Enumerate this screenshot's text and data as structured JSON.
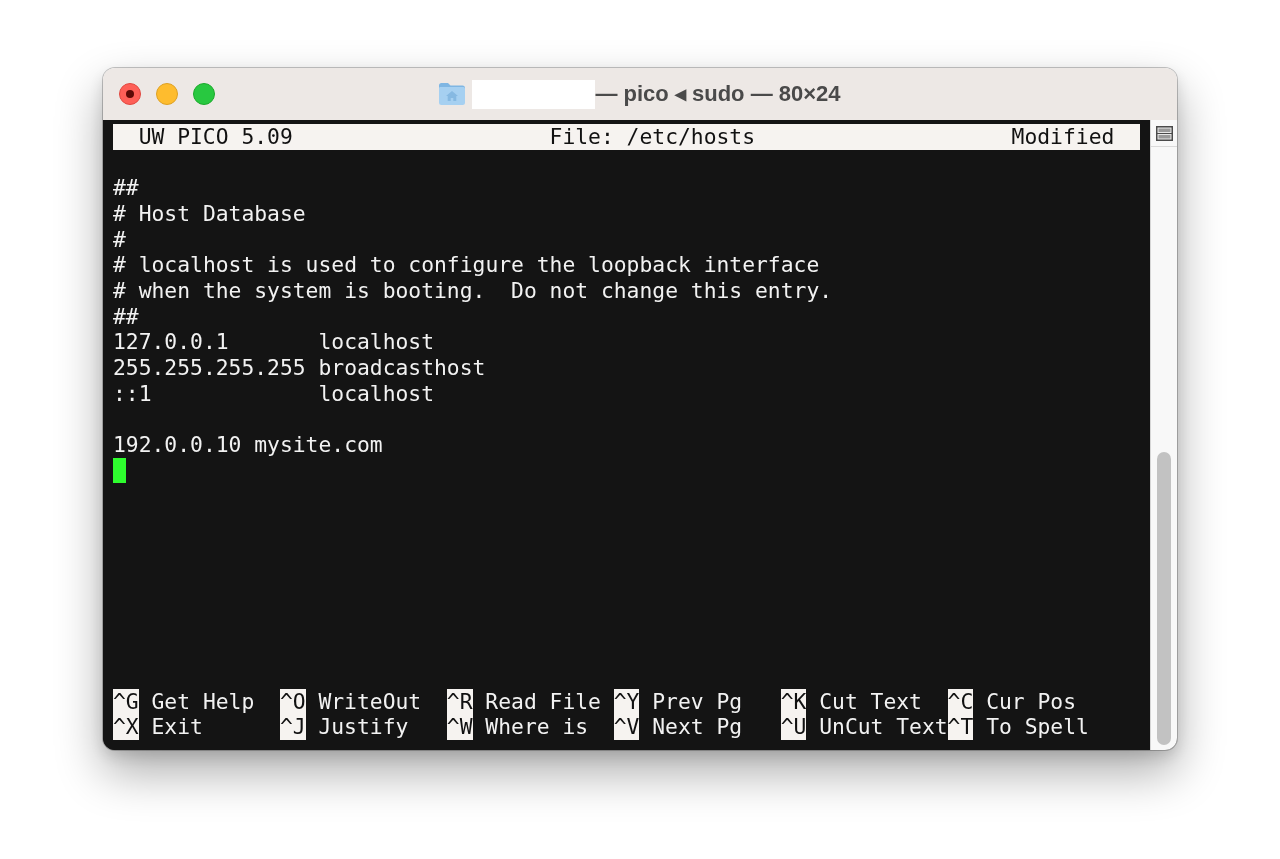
{
  "window": {
    "title": "— pico ◂ sudo — 80×24",
    "edited": true
  },
  "header": {
    "app": "UW PICO 5.09",
    "file": "File: /etc/hosts",
    "status": "Modified"
  },
  "editor": {
    "blocks": [
      [
        "##",
        "# Host Database",
        "#",
        "# localhost is used to configure the loopback interface",
        "# when the system is booting.  Do not change this entry.",
        "##",
        "127.0.0.1       localhost",
        "255.255.255.255 broadcasthost",
        "::1             localhost"
      ],
      [
        "192.0.0.10 mysite.com"
      ]
    ],
    "cursor": true
  },
  "shortcuts": [
    [
      {
        "key": "^G",
        "label": "Get Help"
      },
      {
        "key": "^O",
        "label": "WriteOut"
      },
      {
        "key": "^R",
        "label": "Read File"
      },
      {
        "key": "^Y",
        "label": "Prev Pg"
      },
      {
        "key": "^K",
        "label": "Cut Text"
      },
      {
        "key": "^C",
        "label": "Cur Pos"
      }
    ],
    [
      {
        "key": "^X",
        "label": "Exit"
      },
      {
        "key": "^J",
        "label": "Justify"
      },
      {
        "key": "^W",
        "label": "Where is"
      },
      {
        "key": "^V",
        "label": "Next Pg"
      },
      {
        "key": "^U",
        "label": "UnCut Text"
      },
      {
        "key": "^T",
        "label": "To Spell"
      }
    ]
  ]
}
